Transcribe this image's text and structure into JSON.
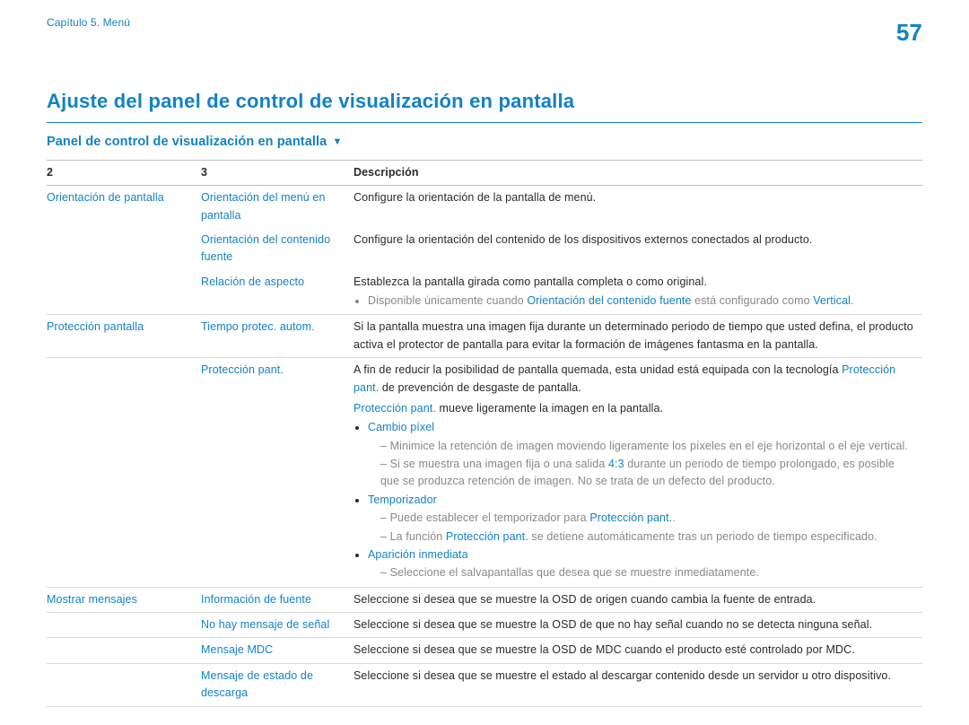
{
  "header": {
    "chapter": "Capítulo 5. Menú",
    "page_number": "57"
  },
  "h1": "Ajuste del panel de control de visualización en pantalla",
  "h2": "Panel de control de visualización en pantalla",
  "table": {
    "columns": {
      "col1": "2",
      "col2": "3",
      "col3": "Descripción"
    }
  },
  "rows": {
    "r1": {
      "l1": "Orientación de pantalla",
      "l2": "Orientación del menú en pantalla",
      "desc": "Configure la orientación de la pantalla de menú."
    },
    "r2": {
      "l2": "Orientación del contenido fuente",
      "desc": "Configure la orientación del contenido de los dispositivos externos conectados al producto."
    },
    "r3": {
      "l2": "Relación de aspecto",
      "desc": "Establezca la pantalla girada como pantalla completa o como original.",
      "note_pre": "Disponible únicamente cuando ",
      "note_mid": "Orientación del contenido fuente",
      "note_post": " está configurado como ",
      "note_end": "Vertical",
      "note_dot": "."
    },
    "r4": {
      "l1": "Protección pantalla",
      "l2": "Tiempo protec. autom.",
      "desc": "Si la pantalla muestra una imagen fija durante un determinado periodo de tiempo que usted defina, el producto activa el protector de pantalla para evitar la formación de imágenes fantasma en la pantalla."
    },
    "r5": {
      "l2": "Protección pant.",
      "p1_pre": "A fin de reducir la posibilidad de pantalla quemada, esta unidad está equipada con la tecnología ",
      "p1_term": "Protección pant.",
      "p1_post": " de prevención de desgaste de pantalla.",
      "p2_term": "Protección pant.",
      "p2_post": " mueve ligeramente la imagen en la pantalla.",
      "b1": "Cambio píxel",
      "b1_s1": "Minimice la retención de imagen moviendo ligeramente los píxeles en el eje horizontal o el eje vertical.",
      "b1_s2_pre": "Si se muestra una imagen fija o una salida ",
      "b1_s2_mid": "4:3",
      "b1_s2_post": " durante un periodo de tiempo prolongado, es posible que se produzca retención de imagen. No se trata de un defecto del producto.",
      "b2": "Temporizador",
      "b2_s1_pre": "Puede establecer el temporizador para ",
      "b2_s1_term": "Protección pant.",
      "b2_s1_dot": ".",
      "b2_s2_pre": "La función ",
      "b2_s2_term": "Protección pant.",
      "b2_s2_post": " se detiene automáticamente tras un periodo de tiempo especificado.",
      "b3": "Aparición inmediata",
      "b3_s1": "Seleccione el salvapantallas que desea que se muestre inmediatamente."
    },
    "r6": {
      "l1": "Mostrar mensajes",
      "l2": "Información de fuente",
      "desc": "Seleccione si desea que se muestre la OSD de origen cuando cambia la fuente de entrada."
    },
    "r7": {
      "l2": "No hay mensaje de señal",
      "desc": "Seleccione si desea que se muestre la OSD de que no hay señal cuando no se detecta ninguna señal."
    },
    "r8": {
      "l2": "Mensaje MDC",
      "desc": "Seleccione si desea que se muestre la OSD de MDC cuando el producto esté controlado por MDC."
    },
    "r9": {
      "l2": "Mensaje de estado de descarga",
      "desc": "Seleccione si desea que se muestre el estado al descargar contenido desde un servidor u otro dispositivo."
    }
  }
}
